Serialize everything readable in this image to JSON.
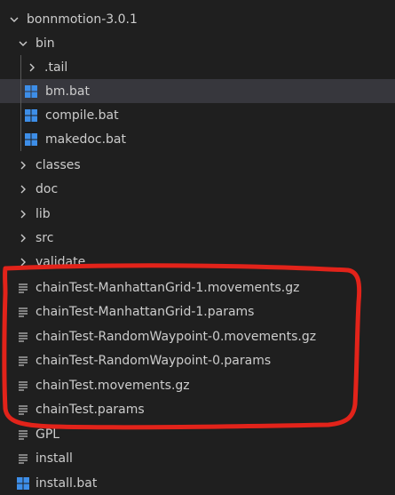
{
  "tree": {
    "root": {
      "label": "bonnmotion-3.0.1",
      "icon": "chevron-down-icon",
      "expanded": true
    },
    "bin": {
      "label": "bin",
      "icon": "chevron-down-icon",
      "expanded": true
    },
    "bin_children": [
      {
        "label": ".tail",
        "kind": "folder",
        "icon": "chevron-right-icon"
      },
      {
        "label": "bm.bat",
        "kind": "file",
        "icon": "windows-logo-icon",
        "selected": true
      },
      {
        "label": "compile.bat",
        "kind": "file",
        "icon": "windows-logo-icon"
      },
      {
        "label": "makedoc.bat",
        "kind": "file",
        "icon": "windows-logo-icon"
      }
    ],
    "folders": [
      {
        "label": "classes",
        "icon": "chevron-right-icon"
      },
      {
        "label": "doc",
        "icon": "chevron-right-icon"
      },
      {
        "label": "lib",
        "icon": "chevron-right-icon"
      },
      {
        "label": "src",
        "icon": "chevron-right-icon"
      },
      {
        "label": "validate",
        "icon": "chevron-right-icon"
      }
    ],
    "files": [
      {
        "label": "chainTest-ManhattanGrid-1.movements.gz",
        "icon": "text-lines-icon"
      },
      {
        "label": "chainTest-ManhattanGrid-1.params",
        "icon": "text-lines-icon"
      },
      {
        "label": "chainTest-RandomWaypoint-0.movements.gz",
        "icon": "text-lines-icon"
      },
      {
        "label": "chainTest-RandomWaypoint-0.params",
        "icon": "text-lines-icon"
      },
      {
        "label": "chainTest.movements.gz",
        "icon": "text-lines-icon"
      },
      {
        "label": "chainTest.params",
        "icon": "text-lines-icon"
      },
      {
        "label": "GPL",
        "icon": "text-lines-icon"
      },
      {
        "label": "install",
        "icon": "text-lines-icon"
      },
      {
        "label": "install.bat",
        "icon": "windows-logo-icon"
      }
    ]
  },
  "colors": {
    "background": "#1f1f1f",
    "selected_row": "#37373d",
    "text": "#cccccc",
    "windows_icon": "#3d8ee8",
    "annotation": "#e2231a"
  }
}
